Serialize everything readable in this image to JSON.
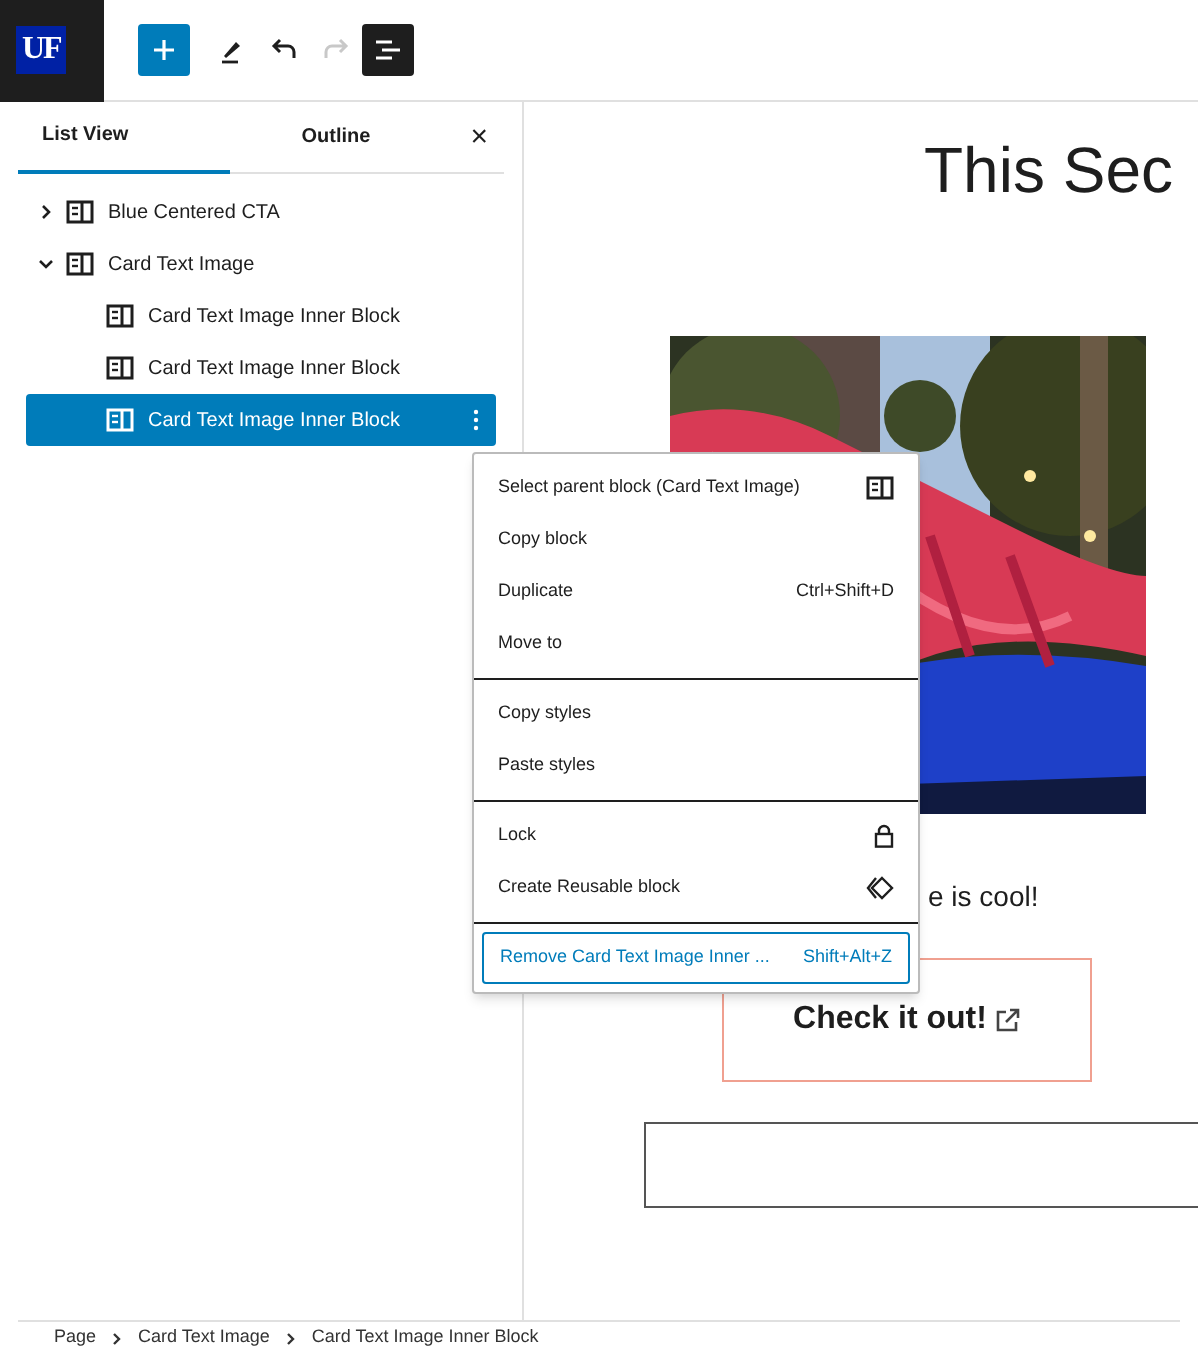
{
  "logo": "UF",
  "toolbar": [
    {
      "kind": "add"
    },
    {
      "kind": "edit"
    },
    {
      "kind": "undo",
      "disabled": false
    },
    {
      "kind": "redo",
      "disabled": true
    },
    {
      "kind": "list",
      "pressed": true
    }
  ],
  "tabs": [
    {
      "label": "List View",
      "selected": true
    },
    {
      "label": "Outline",
      "selected": false
    }
  ],
  "close": "×",
  "tree": [
    {
      "label": "Blue Centered CTA",
      "expanded": false,
      "selected": false
    },
    {
      "label": "Card Text Image",
      "expanded": true,
      "selected": false,
      "children": [
        {
          "label": "Card Text Image Inner Block",
          "selected": false
        },
        {
          "label": "Card Text Image Inner Block",
          "selected": false
        },
        {
          "label": "Card Text Image Inner Block",
          "selected": true
        }
      ]
    }
  ],
  "canvas": {
    "title": "This Sec",
    "caption": "e is cool!",
    "button": "Check it out!"
  },
  "menu": {
    "groups": [
      [
        {
          "label": "Select parent block (Card Text Image)"
        },
        {
          "label": "Copy block"
        },
        {
          "label": "Duplicate",
          "shortcut": "Ctrl+Shift+D"
        },
        {
          "label": "Move to"
        }
      ],
      [
        {
          "label": "Copy styles"
        },
        {
          "label": "Paste styles"
        }
      ],
      [
        {
          "label": "Lock"
        },
        {
          "label": "Create Reusable block"
        }
      ],
      [
        {
          "label": "Remove Card Text Image Inner ...",
          "shortcut": "Shift+Alt+Z",
          "focused": true
        }
      ]
    ]
  },
  "breadcrumb": [
    "Page",
    "Card Text Image",
    "Card Text Image Inner Block"
  ]
}
